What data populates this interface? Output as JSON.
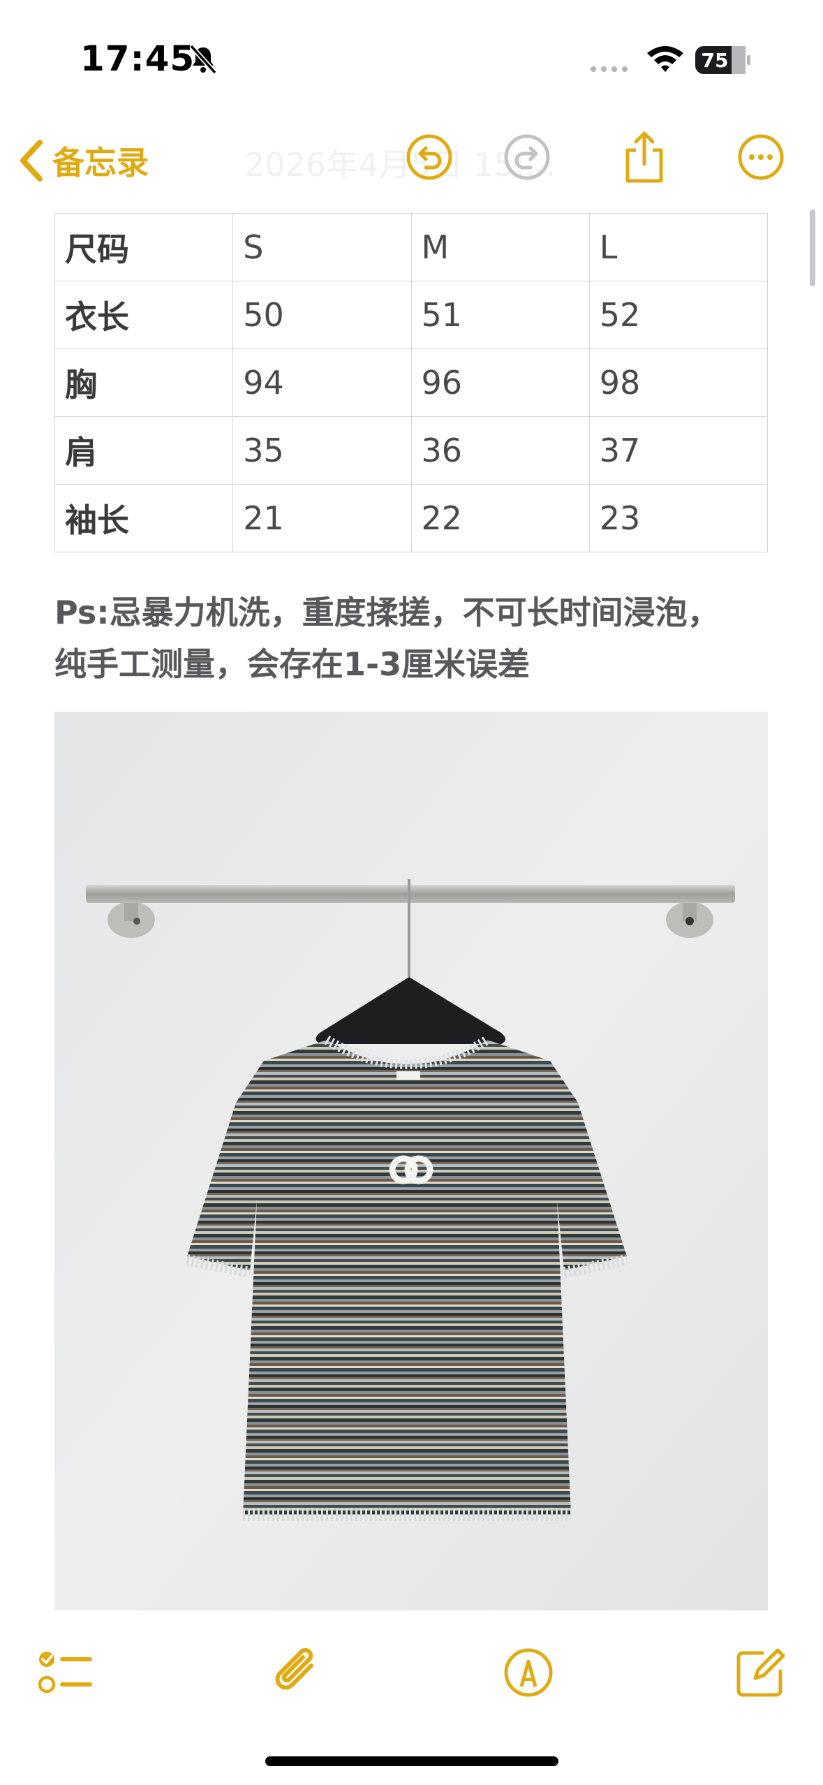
{
  "status_bar": {
    "time": "17:45",
    "battery": "75",
    "accent": "#e0ab12"
  },
  "nav": {
    "back_label": "备忘录",
    "title": "2026年4月5日 15:...",
    "icons": [
      "chevron-left-icon",
      "undo-icon",
      "redo-icon",
      "share-icon",
      "more-icon"
    ]
  },
  "size_table": {
    "rows": [
      [
        "尺码",
        "S",
        "M",
        "L"
      ],
      [
        "衣长",
        "50",
        "51",
        "52"
      ],
      [
        "胸",
        "94",
        "96",
        "98"
      ],
      [
        "肩",
        "35",
        "36",
        "37"
      ],
      [
        "袖长",
        "21",
        "22",
        "23"
      ]
    ]
  },
  "note": {
    "line1": "Ps:忌暴力机洗，重度揉搓，不可长时间浸泡，",
    "line2": "纯手工测量，会存在1-3厘米误差"
  },
  "photo": {
    "brand_label": "CHANEL"
  },
  "toolbar": {
    "icons": [
      "checklist-icon",
      "attachment-icon",
      "markup-icon",
      "compose-icon"
    ]
  }
}
